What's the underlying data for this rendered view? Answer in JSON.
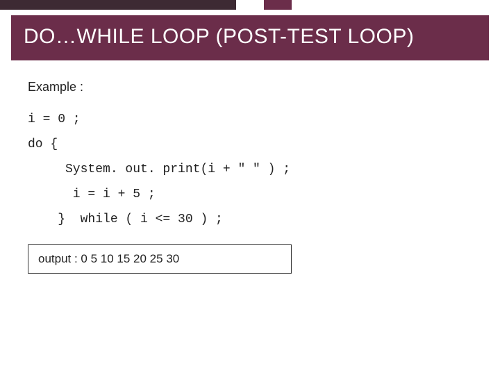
{
  "accent": {
    "dark": "#3d2a33",
    "maroon": "#6b2d4a"
  },
  "title": "DO…WHILE LOOP (POST-TEST LOOP)",
  "example_label": "Example :",
  "code_lines": [
    "i = 0 ;",
    "do {",
    "     System. out. print(i + \" \" ) ;",
    "      i = i + 5 ;",
    "    }  while ( i <= 30 ) ;"
  ],
  "output_label": "output : 0  5  10  15  20  25  30"
}
